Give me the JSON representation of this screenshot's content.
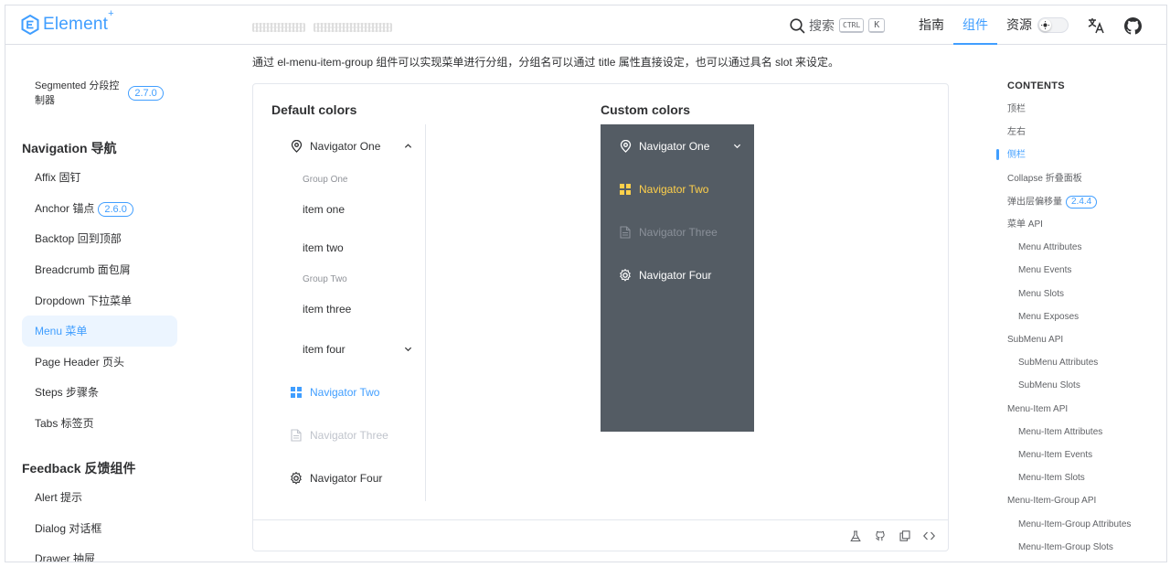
{
  "header": {
    "logo_text": "Element",
    "logo_sup": "+",
    "search_label": "搜索",
    "kbd_ctrl": "CTRL",
    "kbd_k": "K",
    "nav": [
      "指南",
      "组件",
      "资源"
    ],
    "active_nav": "组件",
    "accent": "#409eff"
  },
  "sidebar": {
    "segmented": {
      "label_line1": "Segmented 分段控",
      "label_line2": "制器",
      "badge": "2.7.0"
    },
    "nav_group": "Navigation 导航",
    "nav_items": [
      {
        "label": "Affix 固钉"
      },
      {
        "label": "Anchor 锚点",
        "badge": "2.6.0"
      },
      {
        "label": "Backtop 回到顶部"
      },
      {
        "label": "Breadcrumb 面包屑"
      },
      {
        "label": "Dropdown 下拉菜单"
      },
      {
        "label": "Menu 菜单",
        "active": true
      },
      {
        "label": "Page Header 页头"
      },
      {
        "label": "Steps 步骤条"
      },
      {
        "label": "Tabs 标签页"
      }
    ],
    "feedback_group": "Feedback 反馈组件",
    "feedback_items": [
      {
        "label": "Alert 提示"
      },
      {
        "label": "Dialog 对话框"
      },
      {
        "label": "Drawer 抽屉"
      }
    ]
  },
  "main": {
    "intro": "通过 el-menu-item-group 组件可以实现菜单进行分组，分组名可以通过 title 属性直接设定，也可以通过具名 slot 来设定。",
    "default_title": "Default colors",
    "custom_title": "Custom colors",
    "default_menu": {
      "nav_one": "Navigator One",
      "group_one": "Group One",
      "item_one": "item one",
      "item_two": "item two",
      "group_two": "Group Two",
      "item_three": "item three",
      "item_four": "item four",
      "nav_two": "Navigator Two",
      "nav_three": "Navigator Three",
      "nav_four": "Navigator Four"
    },
    "custom_menu": {
      "nav_one": "Navigator One",
      "nav_two": "Navigator Two",
      "nav_three": "Navigator Three",
      "nav_four": "Navigator Four",
      "background": "#545c64",
      "active_color": "#ffd04b"
    }
  },
  "toc": {
    "heading": "CONTENTS",
    "items": [
      {
        "label": "顶栏"
      },
      {
        "label": "左右"
      },
      {
        "label": "侧栏",
        "active": true
      },
      {
        "label": "Collapse 折叠面板"
      },
      {
        "label": "弹出层偏移量",
        "badge": "2.4.4"
      },
      {
        "label": "菜单 API"
      },
      {
        "label": "Menu Attributes",
        "sub": true
      },
      {
        "label": "Menu Events",
        "sub": true
      },
      {
        "label": "Menu Slots",
        "sub": true
      },
      {
        "label": "Menu Exposes",
        "sub": true
      },
      {
        "label": "SubMenu API"
      },
      {
        "label": "SubMenu Attributes",
        "sub": true
      },
      {
        "label": "SubMenu Slots",
        "sub": true
      },
      {
        "label": "Menu-Item API"
      },
      {
        "label": "Menu-Item Attributes",
        "sub": true
      },
      {
        "label": "Menu-Item Events",
        "sub": true
      },
      {
        "label": "Menu-Item Slots",
        "sub": true
      },
      {
        "label": "Menu-Item-Group API"
      },
      {
        "label": "Menu-Item-Group Attributes",
        "sub": true
      },
      {
        "label": "Menu-Item-Group Slots",
        "sub": true
      }
    ]
  }
}
